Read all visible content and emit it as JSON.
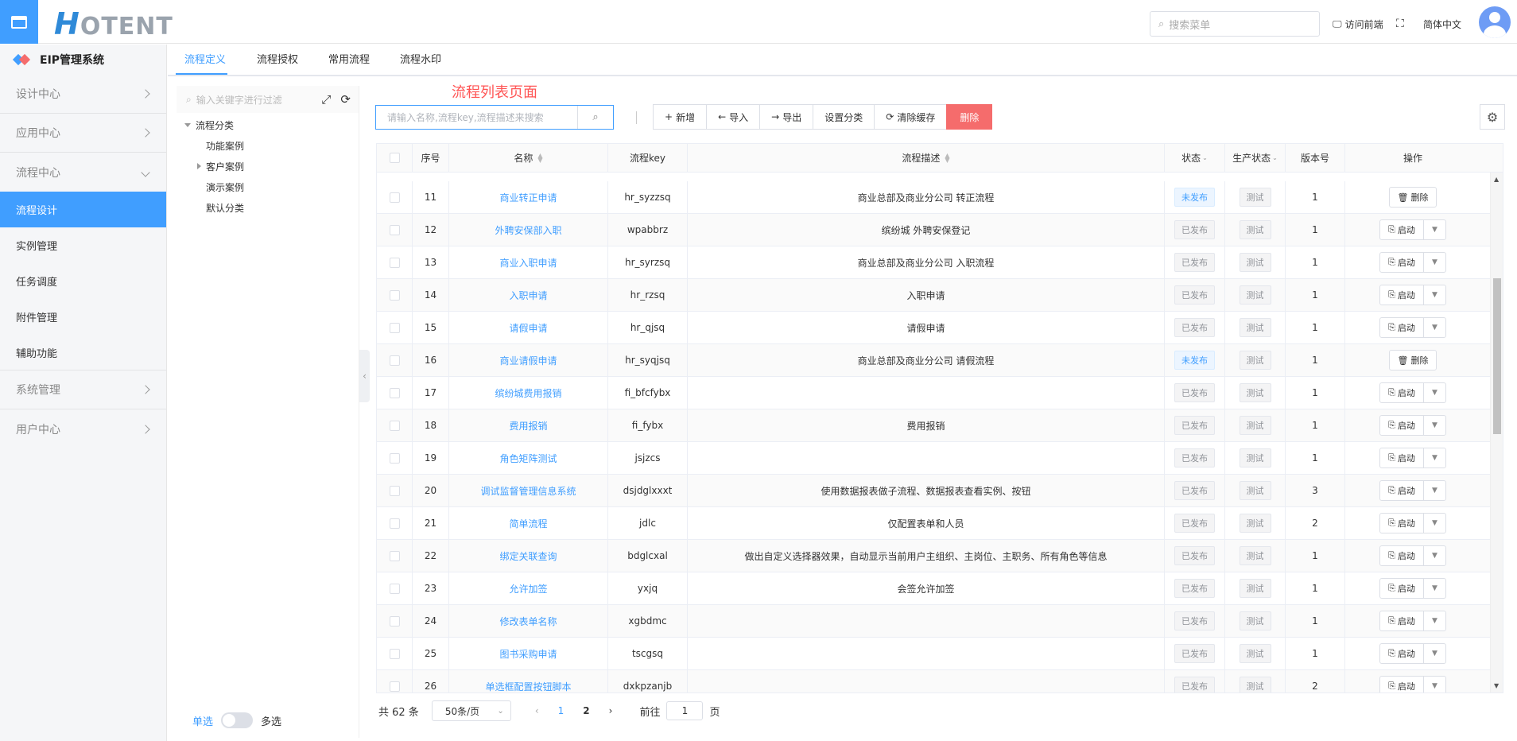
{
  "header": {
    "logo_h": "H",
    "logo_rest": "OTENT",
    "search_placeholder": "搜索菜单",
    "visit_front": "访问前端",
    "language": "简体中文"
  },
  "sidebar": {
    "title": "EIP管理系统",
    "groups": [
      {
        "label": "设计中心"
      },
      {
        "label": "应用中心"
      },
      {
        "label": "流程中心"
      }
    ],
    "items": [
      {
        "label": "流程设计"
      },
      {
        "label": "实例管理"
      },
      {
        "label": "任务调度"
      },
      {
        "label": "附件管理"
      },
      {
        "label": "辅助功能"
      }
    ],
    "groups2": [
      {
        "label": "系统管理"
      },
      {
        "label": "用户中心"
      }
    ]
  },
  "tabs": [
    {
      "label": "流程定义"
    },
    {
      "label": "流程授权"
    },
    {
      "label": "常用流程"
    },
    {
      "label": "流程水印"
    }
  ],
  "tree": {
    "search_placeholder": "输入关键字进行过滤",
    "root": "流程分类",
    "children": [
      "功能案例",
      "客户案例",
      "演示案例",
      "默认分类"
    ],
    "single": "单选",
    "multi": "多选"
  },
  "page_label": "流程列表页面",
  "toolbar": {
    "search_placeholder": "请输入名称,流程key,流程描述来搜索",
    "add": "新增",
    "import": "导入",
    "export": "导出",
    "set_category": "设置分类",
    "clear_cache": "清除缓存",
    "delete": "删除"
  },
  "table": {
    "headers": [
      "序号",
      "名称",
      "流程key",
      "流程描述",
      "状态",
      "生产状态",
      "版本号",
      "操作"
    ],
    "rows": [
      {
        "no": "11",
        "name": "商业转正申请",
        "key": "hr_syzzsq",
        "desc": "商业总部及商业分公司 转正流程",
        "status": "未发布",
        "prod": "测试",
        "ver": "1",
        "op": "删除"
      },
      {
        "no": "12",
        "name": "外聘安保部入职",
        "key": "wpabbrz",
        "desc": "缤纷城 外聘安保登记",
        "status": "已发布",
        "prod": "测试",
        "ver": "1",
        "op": "启动"
      },
      {
        "no": "13",
        "name": "商业入职申请",
        "key": "hr_syrzsq",
        "desc": "商业总部及商业分公司 入职流程",
        "status": "已发布",
        "prod": "测试",
        "ver": "1",
        "op": "启动"
      },
      {
        "no": "14",
        "name": "入职申请",
        "key": "hr_rzsq",
        "desc": "入职申请",
        "status": "已发布",
        "prod": "测试",
        "ver": "1",
        "op": "启动"
      },
      {
        "no": "15",
        "name": "请假申请",
        "key": "hr_qjsq",
        "desc": "请假申请",
        "status": "已发布",
        "prod": "测试",
        "ver": "1",
        "op": "启动"
      },
      {
        "no": "16",
        "name": "商业请假申请",
        "key": "hr_syqjsq",
        "desc": "商业总部及商业分公司 请假流程",
        "status": "未发布",
        "prod": "测试",
        "ver": "1",
        "op": "删除"
      },
      {
        "no": "17",
        "name": "缤纷城费用报销",
        "key": "fi_bfcfybx",
        "desc": "",
        "status": "已发布",
        "prod": "测试",
        "ver": "1",
        "op": "启动"
      },
      {
        "no": "18",
        "name": "费用报销",
        "key": "fi_fybx",
        "desc": "费用报销",
        "status": "已发布",
        "prod": "测试",
        "ver": "1",
        "op": "启动"
      },
      {
        "no": "19",
        "name": "角色矩阵测试",
        "key": "jsjzcs",
        "desc": "",
        "status": "已发布",
        "prod": "测试",
        "ver": "1",
        "op": "启动"
      },
      {
        "no": "20",
        "name": "调试监督管理信息系统",
        "key": "dsjdglxxxt",
        "desc": "使用数据报表做子流程、数据报表查看实例、按钮",
        "status": "已发布",
        "prod": "测试",
        "ver": "3",
        "op": "启动"
      },
      {
        "no": "21",
        "name": "简单流程",
        "key": "jdlc",
        "desc": "仅配置表单和人员",
        "status": "已发布",
        "prod": "测试",
        "ver": "2",
        "op": "启动"
      },
      {
        "no": "22",
        "name": "绑定关联查询",
        "key": "bdglcxal",
        "desc": "做出自定义选择器效果，自动显示当前用户主组织、主岗位、主职务、所有角色等信息",
        "status": "已发布",
        "prod": "测试",
        "ver": "1",
        "op": "启动"
      },
      {
        "no": "23",
        "name": "允许加签",
        "key": "yxjq",
        "desc": "会签允许加签",
        "status": "已发布",
        "prod": "测试",
        "ver": "1",
        "op": "启动"
      },
      {
        "no": "24",
        "name": "修改表单名称",
        "key": "xgbdmc",
        "desc": "",
        "status": "已发布",
        "prod": "测试",
        "ver": "1",
        "op": "启动"
      },
      {
        "no": "25",
        "name": "图书采购申请",
        "key": "tscgsq",
        "desc": "",
        "status": "已发布",
        "prod": "测试",
        "ver": "1",
        "op": "启动"
      },
      {
        "no": "26",
        "name": "单选框配置按钮脚本",
        "key": "dxkpzanjb",
        "desc": "",
        "status": "已发布",
        "prod": "测试",
        "ver": "2",
        "op": "启动"
      }
    ]
  },
  "pager": {
    "total": "共 62 条",
    "size": "50条/页",
    "pages": [
      "1",
      "2"
    ],
    "goto": "前往",
    "goto_value": "1",
    "page_suffix": "页"
  },
  "colors": {
    "primary": "#409eff",
    "danger": "#f56c6c"
  }
}
